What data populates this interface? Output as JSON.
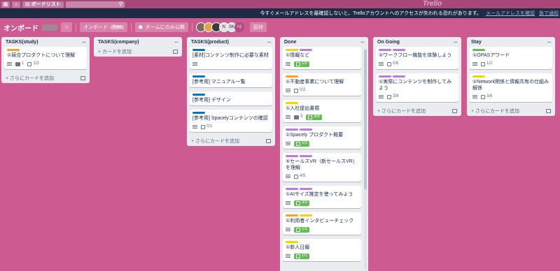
{
  "topbar": {
    "boards_label": "ボードリスト",
    "brand": "Trello"
  },
  "notice": {
    "text": "今すぐメールアドレスを最確認しないと、Trelloアカウントへのアクセスが失われる恐れがあります。",
    "link1": "メールアドレスを確認",
    "link2": "後で通知"
  },
  "board": {
    "title": "オンボード",
    "team_label": "オンボード",
    "team_badge": "Free",
    "visibility": "チームにのみ公開",
    "initials_n": "N",
    "initials_sk": "SK",
    "more_count": "+2",
    "invite": "招待"
  },
  "colors": {
    "board_bg": "#cd5a91",
    "label_orange": "#ff9f1a",
    "label_yellow": "#f2d600",
    "label_purple": "#c377e0",
    "label_green": "#61bd4f",
    "label_blue": "#0079bf"
  },
  "lists": [
    {
      "title": "TASKS(study)",
      "add": "+ さらにカードを追加",
      "cards": [
        {
          "title": "①競合プロダクトについて理解",
          "comments": "1",
          "check": "1/3"
        }
      ]
    },
    {
      "title": "TASKS(company)",
      "add": "+ カードを追加",
      "cards": []
    },
    {
      "title": "TASKS(product)",
      "add": "+ さらにカードを追加",
      "cards": [
        {
          "title": "[素材]コンテンツ制作に必要な素材"
        },
        {
          "title": "[参考用] マニュアル一覧"
        },
        {
          "title": "[参考用] デザイン"
        },
        {
          "title": "[参考用] Spacelyコンテンツの確認",
          "check": "0/1"
        }
      ]
    },
    {
      "title": "Done",
      "cards": [
        {
          "title": "①情報など",
          "check": "1/1"
        },
        {
          "title": "①不動産事業について理解",
          "check": "0/2"
        },
        {
          "title": "①入社提出書類",
          "comments": "3",
          "check": "9/9"
        },
        {
          "title": "①Spacely プロダクト概要",
          "check": "1/1"
        },
        {
          "title": "⑤セールスVR（新セールスVR）を理解",
          "check": "4/5"
        },
        {
          "title": "①AIサイズ推定を使ってみよう",
          "check": "3/3"
        },
        {
          "title": "①利用者インタビューチェック",
          "check": "1/1"
        },
        {
          "title": "①新人日報",
          "check": "1/1"
        }
      ]
    },
    {
      "title": "On Going",
      "add": "+ さらにカードを追加",
      "cards": [
        {
          "title": "②ワークフロー機能を体験しよう",
          "check": "0/6"
        },
        {
          "title": "①実際にコンテンツを制作してみよう",
          "check": "3/8"
        }
      ]
    },
    {
      "title": "Stay",
      "add": "+ さらにカードを追加",
      "cards": [
        {
          "title": "①OPASアワード",
          "check": "1/2"
        },
        {
          "title": "②Network関係と情報共有の仕組み解係",
          "check": "3/6"
        }
      ]
    }
  ]
}
